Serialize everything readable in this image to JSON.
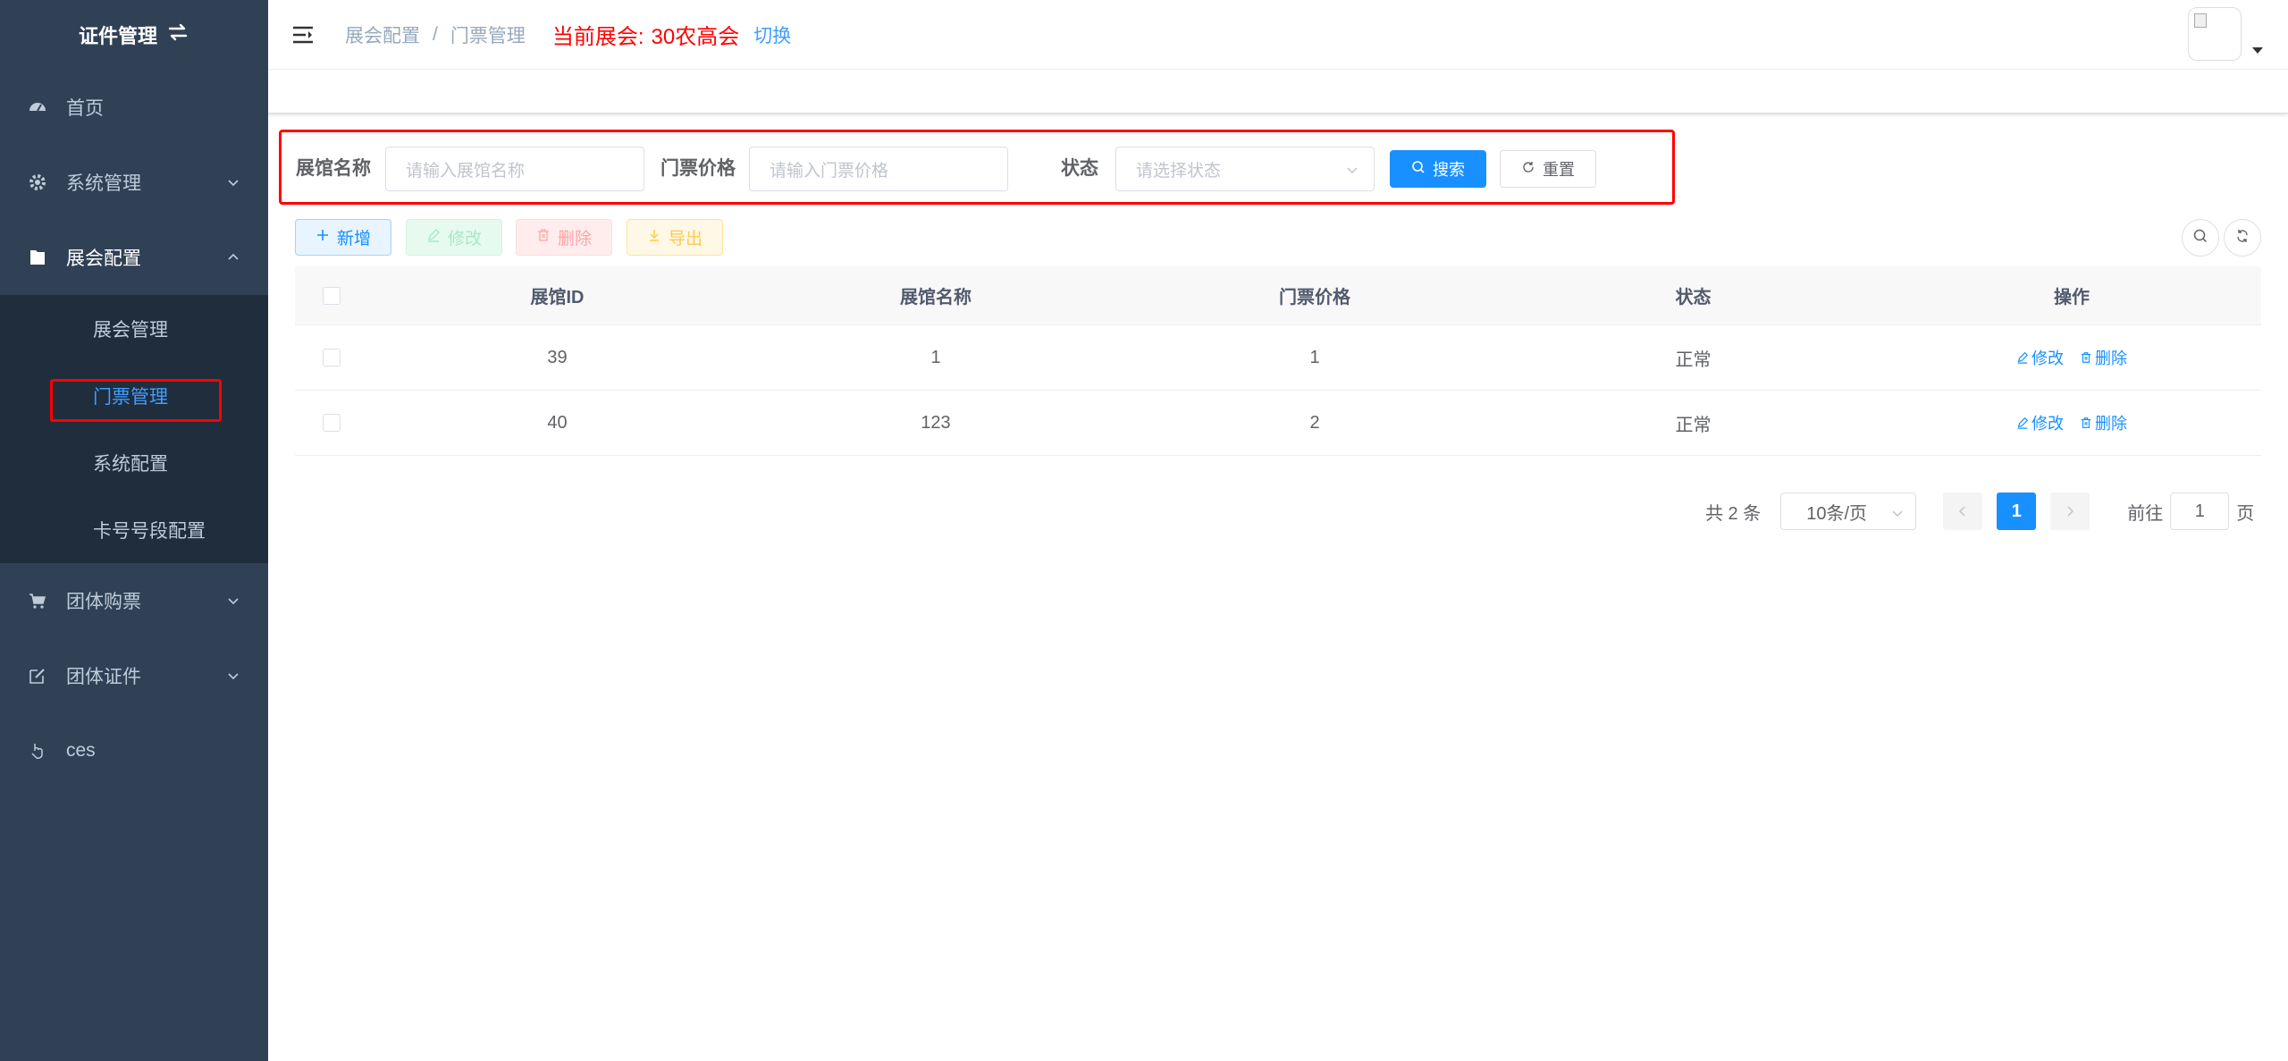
{
  "sidebar": {
    "title": "证件管理",
    "menu": [
      {
        "label": "首页"
      },
      {
        "label": "系统管理"
      },
      {
        "label": "展会配置"
      },
      {
        "label": "团体购票"
      },
      {
        "label": "团体证件"
      },
      {
        "label": "ces"
      }
    ],
    "submenu": [
      {
        "label": "展会管理"
      },
      {
        "label": "门票管理"
      },
      {
        "label": "系统配置"
      },
      {
        "label": "卡号号段配置"
      }
    ]
  },
  "navbar": {
    "breadcrumb": [
      "展会配置",
      "门票管理"
    ],
    "breadcrumb_sep": "/",
    "current_expo_label": "当前展会:",
    "current_expo_name": "30农高会",
    "switch_label": "切换"
  },
  "search": {
    "hall_name_label": "展馆名称",
    "hall_name_placeholder": "请输入展馆名称",
    "price_label": "门票价格",
    "price_placeholder": "请输入门票价格",
    "status_label": "状态",
    "status_placeholder": "请选择状态",
    "search_btn": "搜索",
    "reset_btn": "重置"
  },
  "toolbar": {
    "add": "新增",
    "edit": "修改",
    "delete": "删除",
    "export": "导出"
  },
  "table": {
    "headers": [
      "展馆ID",
      "展馆名称",
      "门票价格",
      "状态",
      "操作"
    ],
    "rows": [
      {
        "id": "39",
        "name": "1",
        "price": "1",
        "status": "正常",
        "edit": "修改",
        "delete": "删除"
      },
      {
        "id": "40",
        "name": "123",
        "price": "2",
        "status": "正常",
        "edit": "修改",
        "delete": "删除"
      }
    ]
  },
  "pagination": {
    "total": "共 2 条",
    "page_size": "10条/页",
    "current_page": "1",
    "goto_label": "前往",
    "goto_value": "1",
    "page_suffix": "页"
  },
  "colors": {
    "sidebar_bg": "#304156",
    "primary": "#1890ff",
    "highlight_red": "#ff0000"
  }
}
